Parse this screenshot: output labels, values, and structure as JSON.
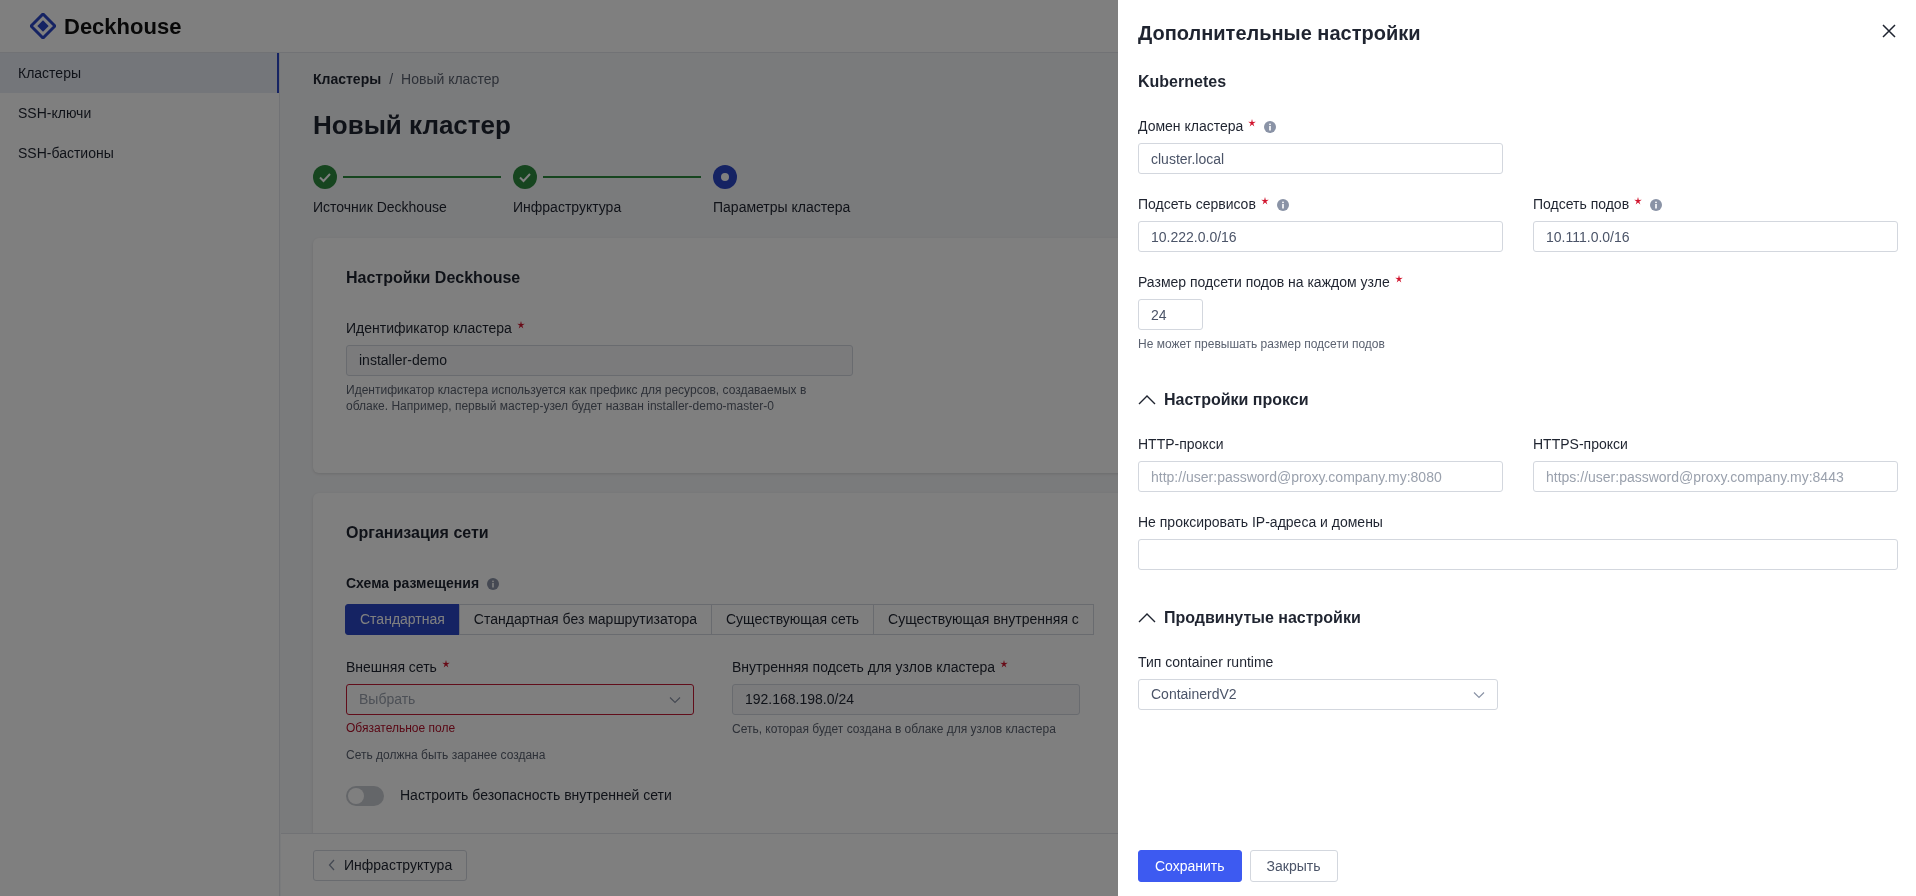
{
  "app": {
    "logo_text": "Deckhouse"
  },
  "sidebar": {
    "items": [
      {
        "label": "Кластеры",
        "selected": true
      },
      {
        "label": "SSH-ключи",
        "selected": false
      },
      {
        "label": "SSH-бастионы",
        "selected": false
      }
    ]
  },
  "breadcrumb": [
    "Кластеры",
    "Новый кластер"
  ],
  "breadcrumb_separator": "/",
  "page_title": "Новый кластер",
  "stepper": [
    {
      "label": "Источник Deckhouse",
      "completed": true,
      "current": false
    },
    {
      "label": "Инфраструктура",
      "completed": true,
      "current": false
    },
    {
      "label": "Параметры кластера",
      "completed": false,
      "current": true
    }
  ],
  "deckhouse_card": {
    "title": "Настройки Deckhouse",
    "field": {
      "label": "Идентификатор кластера",
      "required": true,
      "value": "installer-demo",
      "help": "Идентификатор кластера используется как префикс для ресурсов, создаваемых в облаке. Например, первый мастер-узел будет назван installer-demo-master-0"
    }
  },
  "network_card": {
    "title": "Организация сети",
    "scheme_label": "Схема размещения",
    "scheme_tabs": [
      {
        "label": "Стандартная",
        "selected": true
      },
      {
        "label": "Стандартная без маршрутизатора",
        "selected": false
      },
      {
        "label": "Существующая сеть",
        "selected": false
      },
      {
        "label": "Существующая внутренняя с",
        "selected": false
      }
    ],
    "fields": [
      {
        "kind": "select",
        "label": "Внешняя сеть",
        "required": true,
        "placeholder": "Выбрать",
        "error": "Обязательное поле",
        "help": "Сеть должна быть заранее создана"
      },
      {
        "kind": "text",
        "label": "Внутренняя подсеть для узлов кластера",
        "required": true,
        "value": "192.168.198.0/24",
        "help": "Сеть, которая будет создана в облаке для узлов кластера"
      }
    ],
    "toggle": {
      "label": "Настроить безопасность внутренней сети",
      "on": false
    }
  },
  "footer": {
    "back_button": "Инфраструктура"
  },
  "drawer": {
    "title": "Дополнительные настройки",
    "sections": [
      {
        "title": "Kubernetes",
        "rows": [
          [
            {
              "kind": "text",
              "label": "Домен кластера",
              "required": true,
              "info": true,
              "value": "cluster.local"
            }
          ],
          [
            {
              "kind": "text",
              "label": "Подсеть сервисов",
              "required": true,
              "info": true,
              "value": "10.222.0.0/16"
            },
            {
              "kind": "text",
              "label": "Подсеть подов",
              "required": true,
              "info": true,
              "value": "10.111.0.0/16"
            }
          ],
          [
            {
              "kind": "short",
              "label": "Размер подсети подов на каждом узле",
              "required": true,
              "value": "24",
              "help": "Не может превышать размер подсети подов"
            }
          ]
        ]
      },
      {
        "title": "Настройки прокси",
        "expanded": true,
        "rows": [
          [
            {
              "kind": "text",
              "label": "HTTP-прокси",
              "placeholder": "http://user:password@proxy.company.my:8080"
            },
            {
              "kind": "text",
              "label": "HTTPS-прокси",
              "placeholder": "https://user:password@proxy.company.my:8443"
            }
          ],
          [
            {
              "kind": "wide",
              "label": "Не проксировать IP-адреса и домены"
            }
          ]
        ]
      },
      {
        "title": "Продвинутые настройки",
        "expanded": true,
        "rows": [
          [
            {
              "kind": "select",
              "label": "Тип container runtime",
              "value": "ContainerdV2"
            }
          ]
        ]
      }
    ],
    "buttons": [
      {
        "label": "Сохранить",
        "kind": "primary"
      },
      {
        "label": "Закрыть",
        "kind": "secondary"
      }
    ]
  }
}
